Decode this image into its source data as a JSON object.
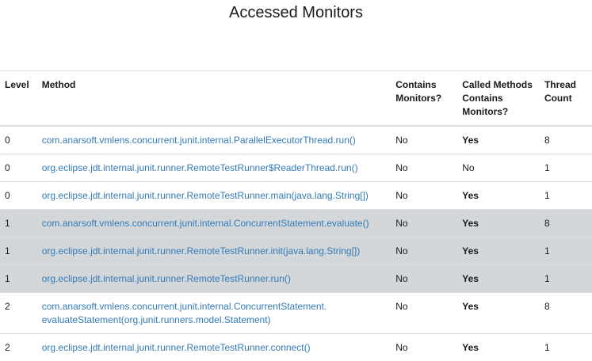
{
  "title": "Accessed Monitors",
  "table": {
    "headers": {
      "level": "Level",
      "method": "Method",
      "contains_line1": "Contains",
      "contains_line2": "Monitors?",
      "called_line1": "Called Methods",
      "called_line2": "Contains",
      "called_line3": "Monitors?",
      "thread_line1": "Thread",
      "thread_line2": "Count"
    },
    "rows": [
      {
        "level": "0",
        "method": "com.anarsoft.vmlens.concurrent.junit.internal.ParallelExecutorThread.run()",
        "method_line2": "",
        "contains": "No",
        "called": "Yes",
        "called_bold": true,
        "thread": "8",
        "highlight": false
      },
      {
        "level": "0",
        "method": "org.eclipse.jdt.internal.junit.runner.RemoteTestRunner$ReaderThread.run()",
        "method_line2": "",
        "contains": "No",
        "called": "No",
        "called_bold": false,
        "thread": "1",
        "highlight": false
      },
      {
        "level": "0",
        "method": "org.eclipse.jdt.internal.junit.runner.RemoteTestRunner.main(java.lang.String[])",
        "method_line2": "",
        "contains": "No",
        "called": "Yes",
        "called_bold": true,
        "thread": "1",
        "highlight": false
      },
      {
        "level": "1",
        "method": "com.anarsoft.vmlens.concurrent.junit.internal.ConcurrentStatement.evaluate()",
        "method_line2": "",
        "contains": "No",
        "called": "Yes",
        "called_bold": true,
        "thread": "8",
        "highlight": true
      },
      {
        "level": "1",
        "method": "org.eclipse.jdt.internal.junit.runner.RemoteTestRunner.init(java.lang.String[])",
        "method_line2": "",
        "contains": "No",
        "called": "Yes",
        "called_bold": true,
        "thread": "1",
        "highlight": true
      },
      {
        "level": "1",
        "method": "org.eclipse.jdt.internal.junit.runner.RemoteTestRunner.run()",
        "method_line2": "",
        "contains": "No",
        "called": "Yes",
        "called_bold": true,
        "thread": "1",
        "highlight": true
      },
      {
        "level": "2",
        "method": "com.anarsoft.vmlens.concurrent.junit.internal.ConcurrentStatement.",
        "method_line2": "evaluateStatement(org.junit.runners.model.Statement)",
        "contains": "No",
        "called": "Yes",
        "called_bold": true,
        "thread": "8",
        "highlight": false
      },
      {
        "level": "2",
        "method": "org.eclipse.jdt.internal.junit.runner.RemoteTestRunner.connect()",
        "method_line2": "",
        "contains": "No",
        "called": "Yes",
        "called_bold": true,
        "thread": "1",
        "highlight": false
      }
    ]
  }
}
